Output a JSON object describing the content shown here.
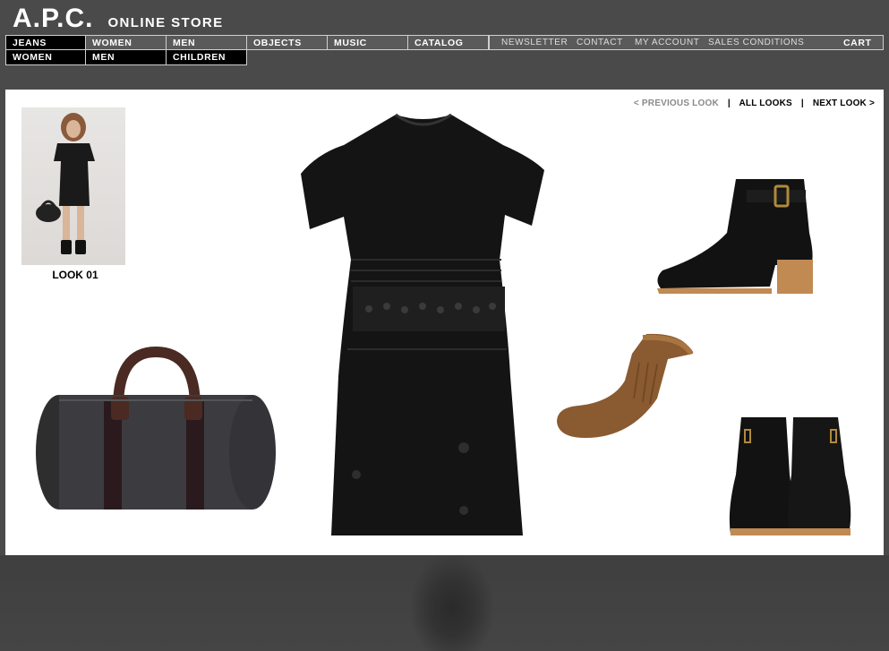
{
  "brand": {
    "logo": "A.P.C.",
    "store": "ONLINE STORE"
  },
  "nav": {
    "row1": [
      "JEANS",
      "WOMEN",
      "MEN",
      "OBJECTS",
      "MUSIC",
      "CATALOG"
    ],
    "row2": [
      "WOMEN",
      "MEN",
      "CHILDREN"
    ]
  },
  "utility": {
    "newsletter": "NEWSLETTER",
    "contact": "CONTACT",
    "account": "MY ACCOUNT",
    "sales": "SALES CONDITIONS",
    "cart": "CART"
  },
  "look_nav": {
    "previous": "< PREVIOUS LOOK",
    "separator": "|",
    "all": "ALL LOOKS",
    "next": "NEXT LOOK >"
  },
  "look": {
    "label": "LOOK 01"
  },
  "products": [
    {
      "icon": "dress-image"
    },
    {
      "icon": "duffle-bag-image"
    },
    {
      "icon": "ankle-boot-side-image"
    },
    {
      "icon": "sock-image"
    },
    {
      "icon": "ankle-boots-front-image"
    }
  ],
  "colors": {
    "background": "#4a4a4a",
    "panel": "#ffffff",
    "nav_active": "#000000",
    "nav_default": "#5a5a5a"
  }
}
